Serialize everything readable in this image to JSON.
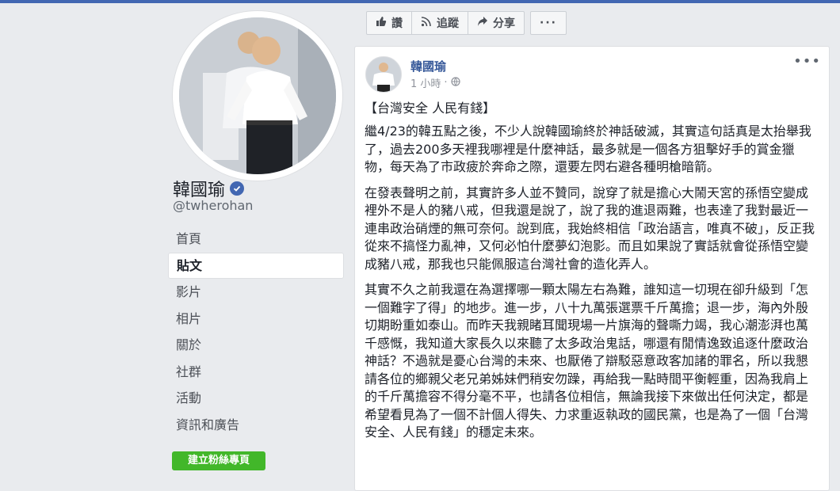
{
  "profile": {
    "name": "韓國瑜",
    "handle": "@twherohan"
  },
  "nav": {
    "items": [
      {
        "label": "首頁"
      },
      {
        "label": "貼文"
      },
      {
        "label": "影片"
      },
      {
        "label": "相片"
      },
      {
        "label": "關於"
      },
      {
        "label": "社群"
      },
      {
        "label": "活動"
      },
      {
        "label": "資訊和廣告"
      }
    ],
    "create_page_label": "建立粉絲專頁"
  },
  "actions": {
    "like_label": "讚",
    "follow_label": "追蹤",
    "share_label": "分享",
    "more_label": "···"
  },
  "post": {
    "author": "韓國瑜",
    "time": "1 小時",
    "title": "【台灣安全 人民有錢】",
    "paragraphs": [
      "繼4/23的韓五點之後，不少人說韓國瑜終於神話破滅，其實這句話真是太抬舉我了，過去200多天裡我哪裡是什麼神話，最多就是一個各方狙擊好手的賞金獵物，每天為了市政疲於奔命之際，還要左閃右避各種明槍暗箭。",
      "在發表聲明之前，其實許多人並不贊同，說穿了就是擔心大鬧天宮的孫悟空變成裡外不是人的豬八戒，但我還是說了，說了我的進退兩難，也表達了我對最近一連串政治硝煙的無可奈何。說到底，我始終相信「政治語言，唯真不破」，反正我從來不搞怪力亂神，又何必怕什麼夢幻泡影。而且如果說了實話就會從孫悟空變成豬八戒，那我也只能佩服這台灣社會的造化弄人。",
      "其實不久之前我還在為選擇哪一顆太陽左右為難，誰知這一切現在卻升級到「怎一個難字了得」的地步。進一步，八十九萬張選票千斤萬擔；退一步，海內外殷切期盼重如泰山。而昨天我親睹耳聞現場一片旗海的聲嘶力竭，我心潮澎湃也萬千感慨，我知道大家長久以來聽了太多政治鬼話，哪還有閒情逸致追逐什麼政治神話？不過就是憂心台灣的未來、也厭倦了辯駁惡意政客加諸的罪名，所以我懇請各位的鄉親父老兄弟姊妹們稍安勿躁，再給我一點時間平衡輕重，因為我肩上的千斤萬擔容不得分毫不平，也請各位相信，無論我接下來做出任何決定，都是希望看見為了一個不計個人得失、力求重返執政的國民黨，也是為了一個「台灣安全、人民有錢」的穩定未來。"
    ]
  },
  "colors": {
    "accent": "#4267b2",
    "link": "#365899",
    "create_button": "#42b72a",
    "background": "#e9ebee"
  },
  "icons": [
    "verified-badge-icon",
    "thumbs-up-icon",
    "rss-follow-icon",
    "share-arrow-icon",
    "globe-icon",
    "more-options-icon"
  ]
}
